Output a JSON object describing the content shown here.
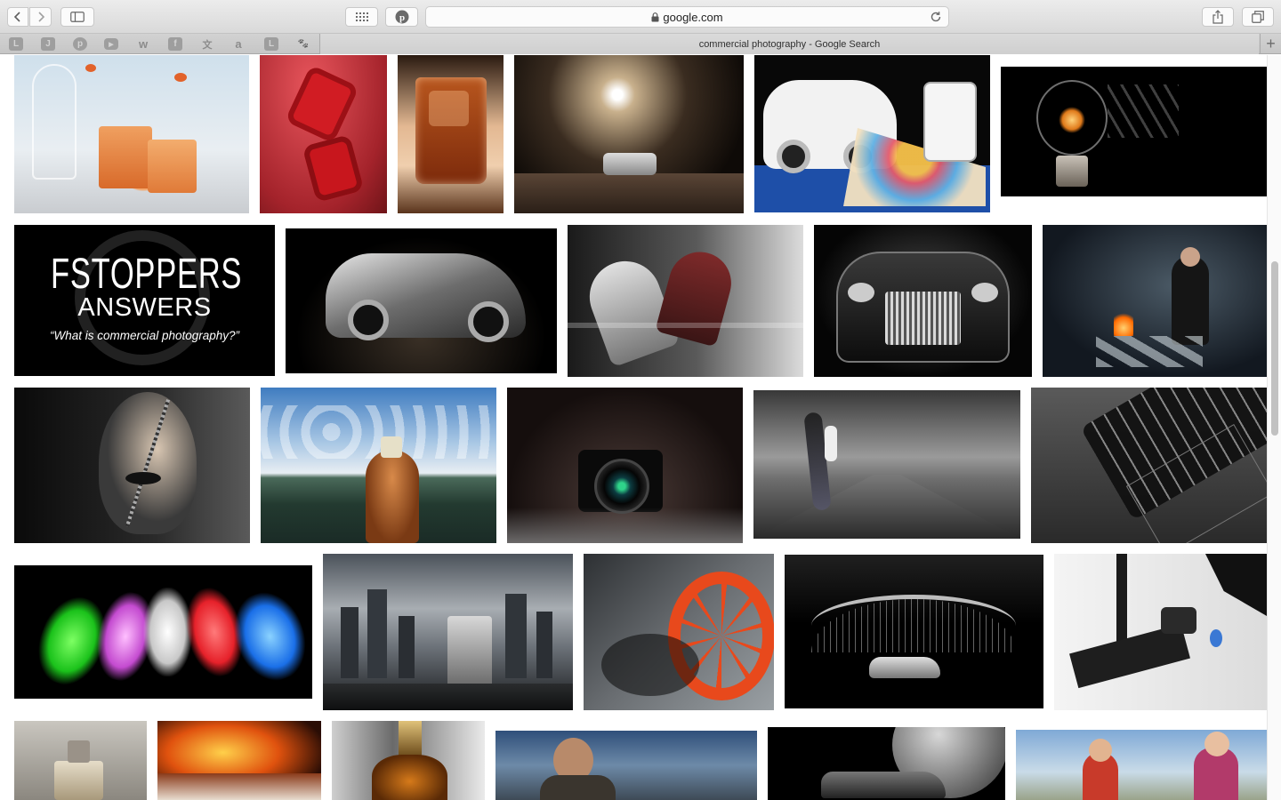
{
  "browser": {
    "address": "google.com",
    "tab_title": "commercial photography - Google Search",
    "new_tab_symbol": "+",
    "favorites": [
      {
        "icon": "letter-l-icon",
        "glyph": "L"
      },
      {
        "icon": "letter-j-icon",
        "glyph": "J"
      },
      {
        "icon": "pinterest-icon",
        "glyph": "p"
      },
      {
        "icon": "youtube-icon",
        "glyph": "▶"
      },
      {
        "icon": "weibo-icon",
        "glyph": "w"
      },
      {
        "icon": "facebook-icon",
        "glyph": "f"
      },
      {
        "icon": "translate-icon",
        "glyph": "文"
      },
      {
        "icon": "amazon-icon",
        "glyph": "a"
      },
      {
        "icon": "letter-l-icon",
        "glyph": "L"
      },
      {
        "icon": "paw-icon",
        "glyph": "🐾"
      }
    ]
  },
  "results": {
    "fstoppers_title": "FSTOPPERS",
    "fstoppers_subtitle": "ANSWERS",
    "fstoppers_question": "“What is commercial photography?”"
  },
  "colors": {
    "chrome_bg": "#dedede",
    "tab_bg": "#cfcfcf",
    "page_bg": "#ffffff"
  }
}
